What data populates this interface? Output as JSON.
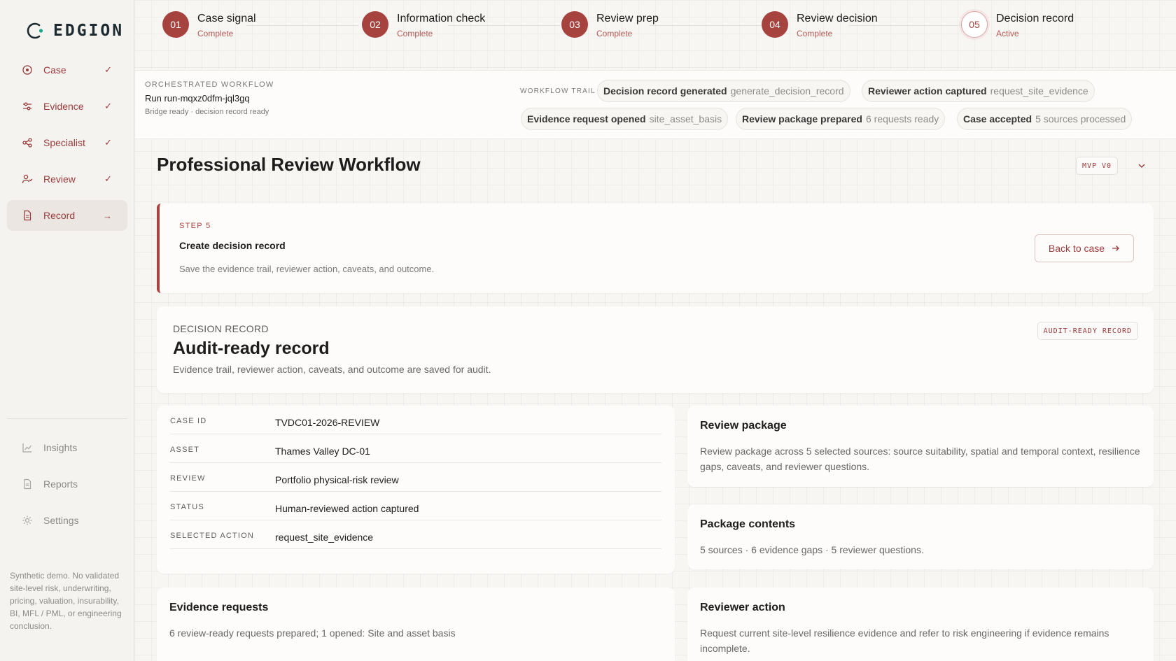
{
  "brand": {
    "name": "EDGION"
  },
  "sidebar": {
    "items": [
      {
        "label": "Case",
        "icon": "target-icon",
        "status": "✓"
      },
      {
        "label": "Evidence",
        "icon": "sliders-icon",
        "status": "✓"
      },
      {
        "label": "Specialist",
        "icon": "share-icon",
        "status": "✓"
      },
      {
        "label": "Review",
        "icon": "user-check-icon",
        "status": "✓"
      },
      {
        "label": "Record",
        "icon": "file-icon",
        "status": "→",
        "active": true
      }
    ],
    "secondary": [
      {
        "label": "Insights",
        "icon": "chart-icon"
      },
      {
        "label": "Reports",
        "icon": "document-icon"
      },
      {
        "label": "Settings",
        "icon": "gear-icon"
      }
    ],
    "disclaimer": "Synthetic demo. No validated site-level risk, underwriting, pricing, valuation, insurability, BI, MFL / PML, or engineering conclusion."
  },
  "stepper": {
    "steps": [
      {
        "num": "01",
        "title": "Case signal",
        "status": "Complete"
      },
      {
        "num": "02",
        "title": "Information check",
        "status": "Complete"
      },
      {
        "num": "03",
        "title": "Review prep",
        "status": "Complete"
      },
      {
        "num": "04",
        "title": "Review decision",
        "status": "Complete"
      },
      {
        "num": "05",
        "title": "Decision record",
        "status": "Active"
      }
    ]
  },
  "workflow": {
    "label": "ORCHESTRATED WORKFLOW",
    "run": "Run run-mqxz0dfm-jql3gq",
    "sub": "Bridge ready · decision record ready",
    "trail_label": "WORKFLOW TRAIL",
    "trail": [
      {
        "name": "Decision record generated",
        "value": "generate_decision_record"
      },
      {
        "name": "Reviewer action captured",
        "value": "request_site_evidence"
      },
      {
        "name": "Evidence request opened",
        "value": "site_asset_basis"
      },
      {
        "name": "Review package prepared",
        "value": "6 requests ready"
      },
      {
        "name": "Case accepted",
        "value": "5 sources processed"
      }
    ]
  },
  "page": {
    "title": "Professional Review Workflow",
    "badge": "MVP V0"
  },
  "step_card": {
    "eyebrow": "STEP 5",
    "title": "Create decision record",
    "desc": "Save the evidence trail, reviewer action, caveats, and outcome.",
    "button": "Back to case"
  },
  "record": {
    "eyebrow": "DECISION RECORD",
    "title": "Audit-ready record",
    "desc": "Evidence trail, reviewer action, caveats, and outcome are saved for audit.",
    "badge": "AUDIT-READY RECORD"
  },
  "details": [
    {
      "key": "CASE ID",
      "value": "TVDC01-2026-REVIEW"
    },
    {
      "key": "ASSET",
      "value": "Thames Valley DC-01"
    },
    {
      "key": "REVIEW",
      "value": "Portfolio physical-risk review"
    },
    {
      "key": "STATUS",
      "value": "Human-reviewed action captured"
    },
    {
      "key": "SELECTED ACTION",
      "value": "request_site_evidence"
    }
  ],
  "review_package": {
    "title": "Review package",
    "body": "Review package across 5 selected sources: source suitability, spatial and temporal context, resilience gaps, caveats, and reviewer questions."
  },
  "package_contents": {
    "title": "Package contents",
    "body": "5 sources · 6 evidence gaps · 5 reviewer questions."
  },
  "evidence_requests": {
    "title": "Evidence requests",
    "body": "6 review-ready requests prepared; 1 opened: Site and asset basis"
  },
  "reviewer_action": {
    "title": "Reviewer action",
    "body": "Request current site-level resilience evidence and refer to risk engineering if evidence remains incomplete."
  },
  "colors": {
    "accent": "#a7433f",
    "teal": "#1aa58c"
  }
}
